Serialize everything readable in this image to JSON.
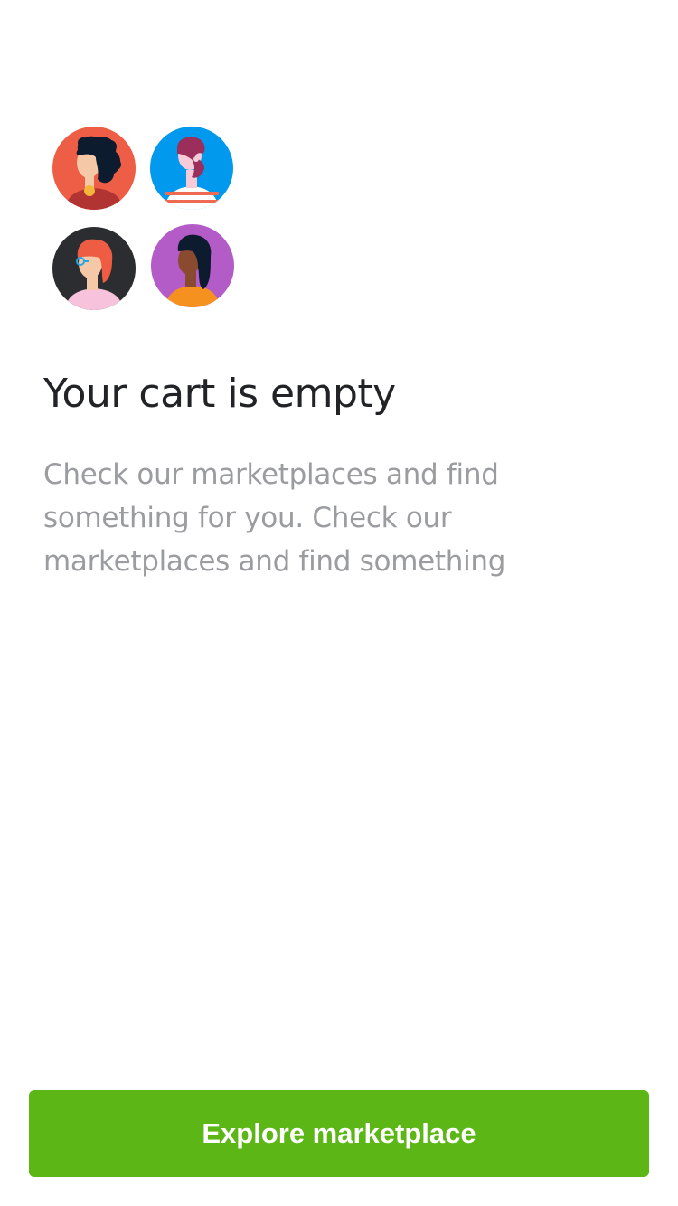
{
  "avatars": [
    {
      "icon": "person-curly-hair-avatar-icon",
      "background": "#ee5d45"
    },
    {
      "icon": "person-bearded-avatar-icon",
      "background": "#0099ee"
    },
    {
      "icon": "person-glasses-avatar-icon",
      "background": "#2c2d31"
    },
    {
      "icon": "person-long-hair-avatar-icon",
      "background": "#b35bc7"
    }
  ],
  "empty_state": {
    "title": "Your cart is empty",
    "description": "Check our marketplaces and find something for you. Check our marketplaces and find something"
  },
  "cta": {
    "label": "Explore marketplace",
    "color": "#5cb716"
  }
}
